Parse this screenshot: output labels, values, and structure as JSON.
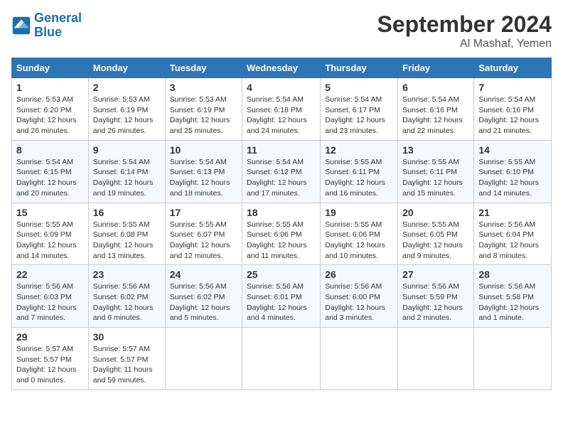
{
  "logo": {
    "text_general": "General",
    "text_blue": "Blue"
  },
  "header": {
    "month": "September 2024",
    "location": "Al Mashaf, Yemen"
  },
  "weekdays": [
    "Sunday",
    "Monday",
    "Tuesday",
    "Wednesday",
    "Thursday",
    "Friday",
    "Saturday"
  ],
  "weeks": [
    [
      {
        "day": "1",
        "sunrise": "5:53 AM",
        "sunset": "6:20 PM",
        "daylight": "12 hours and 26 minutes."
      },
      {
        "day": "2",
        "sunrise": "5:53 AM",
        "sunset": "6:19 PM",
        "daylight": "12 hours and 26 minutes."
      },
      {
        "day": "3",
        "sunrise": "5:53 AM",
        "sunset": "6:19 PM",
        "daylight": "12 hours and 25 minutes."
      },
      {
        "day": "4",
        "sunrise": "5:54 AM",
        "sunset": "6:18 PM",
        "daylight": "12 hours and 24 minutes."
      },
      {
        "day": "5",
        "sunrise": "5:54 AM",
        "sunset": "6:17 PM",
        "daylight": "12 hours and 23 minutes."
      },
      {
        "day": "6",
        "sunrise": "5:54 AM",
        "sunset": "6:16 PM",
        "daylight": "12 hours and 22 minutes."
      },
      {
        "day": "7",
        "sunrise": "5:54 AM",
        "sunset": "6:16 PM",
        "daylight": "12 hours and 21 minutes."
      }
    ],
    [
      {
        "day": "8",
        "sunrise": "5:54 AM",
        "sunset": "6:15 PM",
        "daylight": "12 hours and 20 minutes."
      },
      {
        "day": "9",
        "sunrise": "5:54 AM",
        "sunset": "6:14 PM",
        "daylight": "12 hours and 19 minutes."
      },
      {
        "day": "10",
        "sunrise": "5:54 AM",
        "sunset": "6:13 PM",
        "daylight": "12 hours and 18 minutes."
      },
      {
        "day": "11",
        "sunrise": "5:54 AM",
        "sunset": "6:12 PM",
        "daylight": "12 hours and 17 minutes."
      },
      {
        "day": "12",
        "sunrise": "5:55 AM",
        "sunset": "6:11 PM",
        "daylight": "12 hours and 16 minutes."
      },
      {
        "day": "13",
        "sunrise": "5:55 AM",
        "sunset": "6:11 PM",
        "daylight": "12 hours and 15 minutes."
      },
      {
        "day": "14",
        "sunrise": "5:55 AM",
        "sunset": "6:10 PM",
        "daylight": "12 hours and 14 minutes."
      }
    ],
    [
      {
        "day": "15",
        "sunrise": "5:55 AM",
        "sunset": "6:09 PM",
        "daylight": "12 hours and 14 minutes."
      },
      {
        "day": "16",
        "sunrise": "5:55 AM",
        "sunset": "6:08 PM",
        "daylight": "12 hours and 13 minutes."
      },
      {
        "day": "17",
        "sunrise": "5:55 AM",
        "sunset": "6:07 PM",
        "daylight": "12 hours and 12 minutes."
      },
      {
        "day": "18",
        "sunrise": "5:55 AM",
        "sunset": "6:06 PM",
        "daylight": "12 hours and 11 minutes."
      },
      {
        "day": "19",
        "sunrise": "5:55 AM",
        "sunset": "6:06 PM",
        "daylight": "12 hours and 10 minutes."
      },
      {
        "day": "20",
        "sunrise": "5:55 AM",
        "sunset": "6:05 PM",
        "daylight": "12 hours and 9 minutes."
      },
      {
        "day": "21",
        "sunrise": "5:56 AM",
        "sunset": "6:04 PM",
        "daylight": "12 hours and 8 minutes."
      }
    ],
    [
      {
        "day": "22",
        "sunrise": "5:56 AM",
        "sunset": "6:03 PM",
        "daylight": "12 hours and 7 minutes."
      },
      {
        "day": "23",
        "sunrise": "5:56 AM",
        "sunset": "6:02 PM",
        "daylight": "12 hours and 6 minutes."
      },
      {
        "day": "24",
        "sunrise": "5:56 AM",
        "sunset": "6:02 PM",
        "daylight": "12 hours and 5 minutes."
      },
      {
        "day": "25",
        "sunrise": "5:56 AM",
        "sunset": "6:01 PM",
        "daylight": "12 hours and 4 minutes."
      },
      {
        "day": "26",
        "sunrise": "5:56 AM",
        "sunset": "6:00 PM",
        "daylight": "12 hours and 3 minutes."
      },
      {
        "day": "27",
        "sunrise": "5:56 AM",
        "sunset": "5:59 PM",
        "daylight": "12 hours and 2 minutes."
      },
      {
        "day": "28",
        "sunrise": "5:56 AM",
        "sunset": "5:58 PM",
        "daylight": "12 hours and 1 minute."
      }
    ],
    [
      {
        "day": "29",
        "sunrise": "5:57 AM",
        "sunset": "5:57 PM",
        "daylight": "12 hours and 0 minutes."
      },
      {
        "day": "30",
        "sunrise": "5:57 AM",
        "sunset": "5:57 PM",
        "daylight": "11 hours and 59 minutes."
      },
      null,
      null,
      null,
      null,
      null
    ]
  ],
  "labels": {
    "sunrise": "Sunrise:",
    "sunset": "Sunset:",
    "daylight": "Daylight:"
  }
}
